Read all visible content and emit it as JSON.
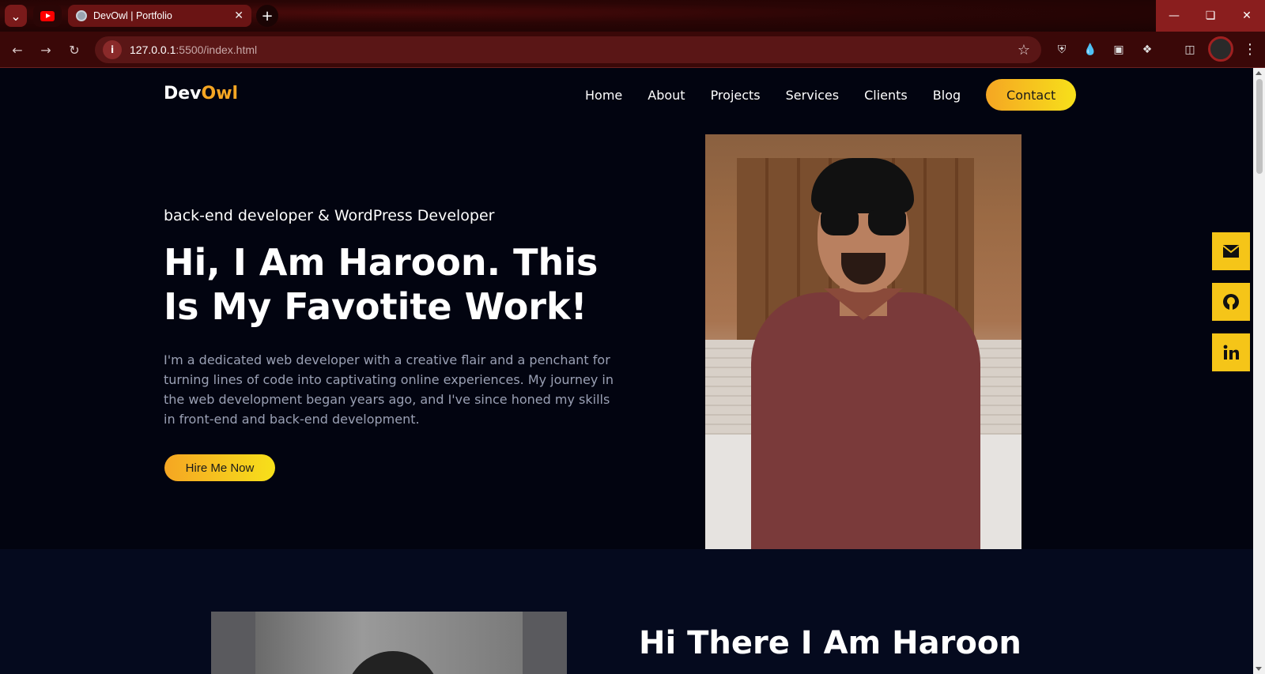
{
  "browser": {
    "tab_title": "DevOwl | Portfolio",
    "url_host": "127.0.0.1",
    "url_path": ":5500/index.html"
  },
  "site": {
    "logo_main": "Dev",
    "logo_accent": "Owl",
    "nav": [
      "Home",
      "About",
      "Projects",
      "Services",
      "Clients",
      "Blog"
    ],
    "contact_label": "Contact"
  },
  "hero": {
    "tagline": "back-end developer & WordPress Developer",
    "headline": "Hi, I Am Haroon. This Is My Favotite Work!",
    "description": "I'm a dedicated web developer with a creative flair and a penchant for turning lines of code into captivating online experiences. My journey in the web development began years ago, and I've since honed my skills in front-end and back-end development.",
    "cta_label": "Hire Me Now"
  },
  "social": [
    {
      "icon": "mail-icon"
    },
    {
      "icon": "github-icon"
    },
    {
      "icon": "linkedin-icon"
    }
  ],
  "about": {
    "title": "Hi There I Am Haroon"
  },
  "colors": {
    "accent_start": "#f5a623",
    "accent_end": "#f7e01a",
    "page_bg": "#020410",
    "social_bg": "#f5c518"
  }
}
